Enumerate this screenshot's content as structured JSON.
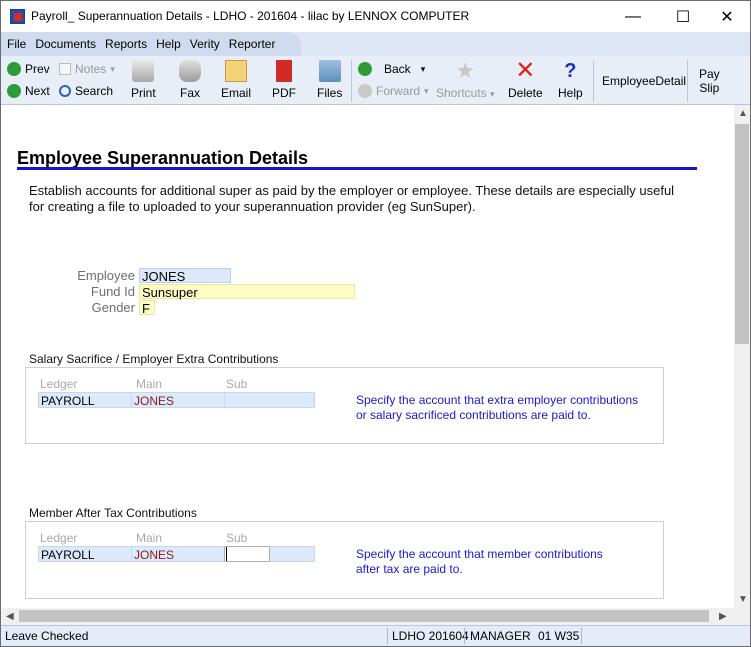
{
  "window": {
    "title": "Payroll_ Superannuation Details - LDHO - 201604 - lilac by LENNOX COMPUTER",
    "minimize_glyph": "—",
    "maximize_glyph": "☐",
    "close_glyph": "✕"
  },
  "menu": [
    "File",
    "Documents",
    "Reports",
    "Help",
    "Verity",
    "Reporter"
  ],
  "toolbar": {
    "prev": "Prev",
    "next": "Next",
    "notes": "Notes",
    "search": "Search",
    "print": "Print",
    "fax": "Fax",
    "email": "Email",
    "pdf": "PDF",
    "files": "Files",
    "back": "Back",
    "forward": "Forward",
    "shortcuts": "Shortcuts",
    "delete": "Delete",
    "help": "Help",
    "employee_detail": "EmployeeDetail",
    "pay_slip_1": "Pay",
    "pay_slip_2": "Slip"
  },
  "page": {
    "title": "Employee Superannuation Details",
    "intro": "Establish accounts for additional super as paid by the employer or employee. These details are especially useful for creating a file to uploaded to your superannuation provider (eg SunSuper)."
  },
  "form": {
    "employee_label": "Employee",
    "employee_value": "JONES",
    "fund_label": "Fund Id",
    "fund_value": "Sunsuper",
    "gender_label": "Gender",
    "gender_value": "F"
  },
  "salary_section": {
    "title": "Salary Sacrifice / Employer Extra Contributions",
    "col_ledger": "Ledger",
    "col_main": "Main",
    "col_sub": "Sub",
    "ledger": "PAYROLL",
    "main": "JONES",
    "sub": "",
    "hint_1": "Specify the account that extra employer contributions",
    "hint_2": "or salary sacrificed contributions are paid to."
  },
  "member_section": {
    "title": "Member After Tax Contributions",
    "col_ledger": "Ledger",
    "col_main": "Main",
    "col_sub": "Sub",
    "ledger": "PAYROLL",
    "main": "JONES",
    "sub": "",
    "hint_1": "Specify the account that member contributions",
    "hint_2": "after tax are paid to."
  },
  "status": {
    "left": "Leave Checked",
    "company": "LDHO 201604",
    "user": "MANAGER",
    "period": "01 W35"
  },
  "colors": {
    "accent_rule": "#1515c8",
    "hint_text": "#1a1ad0",
    "field_blue": "#dbe9fb",
    "field_yellow": "#fffbc4"
  }
}
